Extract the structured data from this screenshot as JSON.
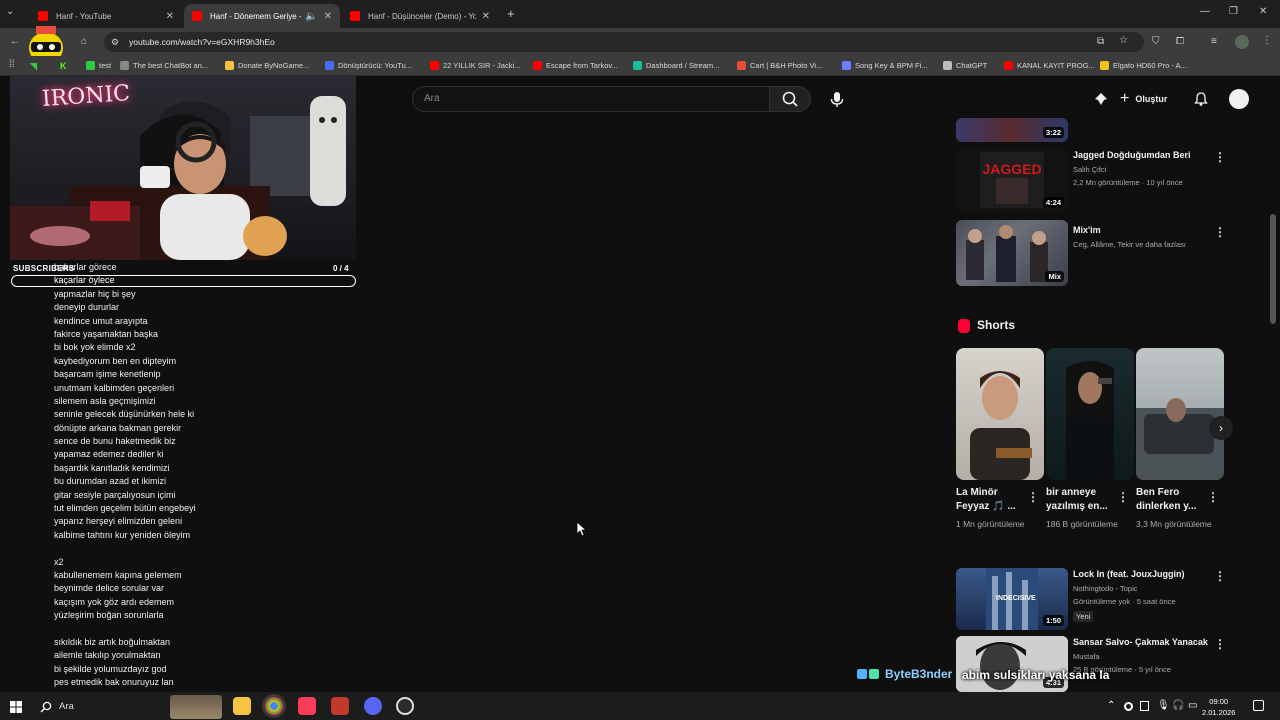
{
  "browser": {
    "tabs": [
      {
        "title": "Hanf - YouTube",
        "active": false
      },
      {
        "title": "Hanf - Dönemem Geriye - Y",
        "active": true
      },
      {
        "title": "Hanf - Düşünceler (Demo) - Yo",
        "active": false
      }
    ],
    "url": "youtube.com/watch?v=eGXHR9h3hEo",
    "bookmarks": [
      {
        "label": "test",
        "color": "#2ecc40"
      },
      {
        "label": "The best ChatBot an...",
        "color": "#888888"
      },
      {
        "label": "Donate ByNoGame...",
        "color": "#f5c542"
      },
      {
        "label": "Dönüştürücü: YouTu...",
        "color": "#4a6cf7"
      },
      {
        "label": "22 YILLIK SIR - Jacki...",
        "color": "#ff0000"
      },
      {
        "label": "Escape from Tarkov...",
        "color": "#ff0000"
      },
      {
        "label": "Dashboard / Stream...",
        "color": "#1abc9c"
      },
      {
        "label": "Cart | B&H Photo Vi...",
        "color": "#e74c3c"
      },
      {
        "label": "Song Key & BPM Fi...",
        "color": "#6c7cff"
      },
      {
        "label": "ChatGPT",
        "color": "#bbbbbb"
      },
      {
        "label": "KANAL KAYIT PROG...",
        "color": "#ff0000"
      },
      {
        "label": "Elgato HD60 Pro - A...",
        "color": "#f1c40f"
      }
    ]
  },
  "youtube": {
    "search_placeholder": "Ara",
    "create_label": "Oluştur"
  },
  "overlay": {
    "webcam_sign": "IRONIC",
    "subscribers_label": "SUBSCRIBERS",
    "subscribers_count": "0 / 4",
    "subscribers_progress": 0,
    "chat_user": "ByteB3nder",
    "chat_message": "abim sulsikları yaksana la"
  },
  "lyrics": [
    "bakarlar görece",
    "kaçarlar öylece",
    "yapmazlar hiç bi şey",
    "deneyip dururlar",
    "kendince umut arayıpta",
    "fakirce yaşamaktan başka",
    "bi bok yok elimde x2",
    "kaybediyorum ben en dipteyim",
    "başarcam işime kenetlenip",
    "unutmam kalbimden geçenleri",
    "silemem asla geçmişimizi",
    "seninle gelecek düşünürken hele ki",
    "dönüpte arkana bakman gerekir",
    "sence de bunu haketmedik biz",
    "yapamaz edemez dediler ki",
    "başardık kanıtladık kendimizi",
    "bu durumdan azad et ikimizi",
    "gitar sesiyle parçalıyosun içimi",
    "tut elimden geçelim bütün engebeyi",
    "yaparız herşeyi elimizden geleni",
    "kalbime tahtını kur yeniden öleyim",
    "",
    "x2",
    "kabullenemem kapına gelemem",
    "beynimde delice sorular var",
    "kaçışım yok göz ardı edemem",
    "yüzleşirim boğan sorunlarla",
    "",
    "sıkıldık biz artık boğulmaktan",
    "ailemle takılıp yorulmaktan",
    "bi şekilde yolumuzdayız god",
    "pes etmedik bak onuruyuz lan"
  ],
  "sidebar_videos": [
    {
      "title": "",
      "channel": "",
      "meta": "",
      "duration": "3:22"
    },
    {
      "title": "Jagged Doğduğumdan Beri",
      "channel": "Salih Çifci",
      "meta": "2,2 Mn görüntüleme · 10 yıl önce",
      "duration": "4:24"
    },
    {
      "title": "Mix'im",
      "channel": "Ceg, Allâme, Tekir ve daha fazlası",
      "meta": "",
      "duration": "Mix"
    }
  ],
  "shorts": {
    "heading": "Shorts",
    "items": [
      {
        "title": "La Minör Feyyaz 🎵 ...",
        "views": "1 Mn görüntüleme"
      },
      {
        "title": "bir anneye yazılmış en...",
        "views": "186 B görüntüleme"
      },
      {
        "title": "Ben Fero dinlerken y...",
        "views": "3,3 Mn görüntüleme"
      }
    ]
  },
  "more_videos": [
    {
      "title": "Lock In (feat. JouxJuggin)",
      "channel": "Nothingtodo - Topic",
      "meta": "Görüntüleme yok · 5 saat önce",
      "badge": "Yeni",
      "duration": "1:50",
      "thumb_text": "INDECISIVE"
    },
    {
      "title": "Sansar Salvo- Çakmak Yanacak",
      "channel": "Mustafa",
      "meta": "25 B görüntüleme · 5 yıl önce",
      "duration": "4:31"
    }
  ],
  "taskbar": {
    "search_label": "Ara",
    "time": "09:00",
    "date": "2.01.2026"
  }
}
